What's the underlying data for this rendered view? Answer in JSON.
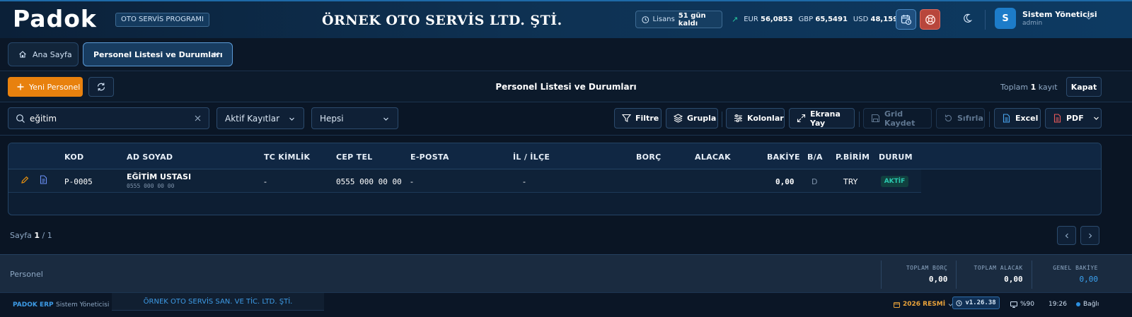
{
  "header": {
    "logo_text": "Padok",
    "app_badge": "OTO SERVİS PROGRAMI",
    "company_name": "ÖRNEK OTO SERVİS LTD. ŞTİ.",
    "license_label": "Lisans",
    "license_value": "51 gün kaldı",
    "rates": [
      {
        "code": "EUR",
        "value": "56,0853"
      },
      {
        "code": "GBP",
        "value": "65,5491"
      },
      {
        "code": "USD",
        "value": "48,1598"
      }
    ],
    "user": {
      "initial": "S",
      "name": "Sistem Yöneticisi",
      "role": "admin"
    }
  },
  "tabs": [
    {
      "label": "Ana Sayfa"
    },
    {
      "label": "Personel Listesi ve Durumları"
    }
  ],
  "toolbar": {
    "new_label": "Yeni Personel",
    "page_title": "Personel Listesi ve Durumları",
    "total_prefix": "Toplam",
    "total_count": "1",
    "total_suffix": "kayıt",
    "close_label": "Kapat"
  },
  "filters": {
    "search_value": "eğitim",
    "record_filter": "Aktif Kayıtlar",
    "type_filter": "Hepsi",
    "buttons": {
      "filter": "Filtre",
      "group": "Grupla",
      "columns": "Kolonlar",
      "fullscreen": "Ekrana Yay",
      "save_grid": "Grid Kaydet",
      "reset": "Sıfırla",
      "excel": "Excel",
      "pdf": "PDF"
    }
  },
  "table": {
    "columns": [
      "KOD",
      "AD SOYAD",
      "TC KİMLİK",
      "CEP TEL",
      "E-POSTA",
      "İL / İLÇE",
      "BORÇ",
      "ALACAK",
      "BAKİYE",
      "B/A",
      "P.BİRİM",
      "DURUM"
    ],
    "rows": [
      {
        "kod": "P-0005",
        "ad_soyad": "EĞİTİM USTASI",
        "ad_sub": "0555 000 00 00",
        "tc": "-",
        "cep": "0555 000 00 00",
        "eposta": "-",
        "il_ilce": "-",
        "borc": "",
        "alacak": "",
        "bakiye": "0,00",
        "ba": "D",
        "pbirim": "TRY",
        "durum": "AKTİF"
      }
    ]
  },
  "pagination": {
    "label": "Sayfa",
    "current": "1",
    "sep": "/",
    "total": "1"
  },
  "footer": {
    "label": "Personel",
    "totals": [
      {
        "label": "TOPLAM BORÇ",
        "value": "0,00"
      },
      {
        "label": "TOPLAM ALACAK",
        "value": "0,00"
      },
      {
        "label": "GENEL BAKİYE",
        "value": "0,00"
      }
    ]
  },
  "statusbar": {
    "brand": "PADOK ERP",
    "user": "Sistem Yöneticisi",
    "company": "ÖRNEK OTO SERVİS SAN. VE TİC. LTD. ŞTİ.",
    "year": "2026 RESMİ",
    "version": "v1.26.38",
    "zoom": "%90",
    "time": "19:26",
    "connection": "Bağlı"
  },
  "colors": {
    "accent": "#e8810e",
    "primary": "#1d7cc9",
    "active_badge": "#2ac9b0",
    "background": "#0a1524"
  }
}
